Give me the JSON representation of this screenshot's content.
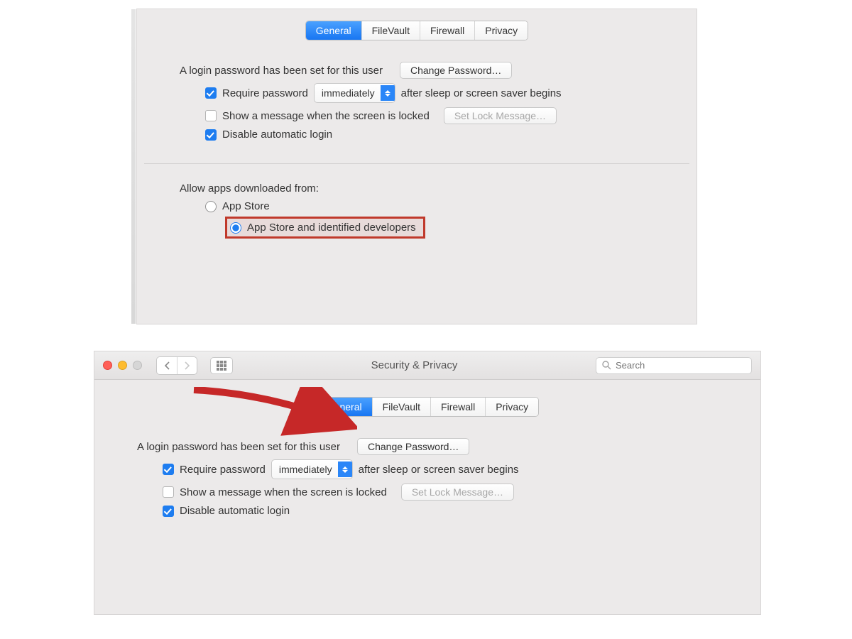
{
  "top": {
    "tabs": {
      "general": "General",
      "filevault": "FileVault",
      "firewall": "Firewall",
      "privacy": "Privacy"
    },
    "login_set_text": "A login password has been set for this user",
    "change_password_btn": "Change Password…",
    "require_password_label": "Require password",
    "require_password_select": "immediately",
    "require_password_tail": "after sleep or screen saver begins",
    "show_message_label": "Show a message when the screen is locked",
    "set_lock_message_btn": "Set Lock Message…",
    "disable_auto_login_label": "Disable automatic login",
    "allow_apps_heading": "Allow apps downloaded from:",
    "radio_app_store": "App Store",
    "radio_identified": "App Store and identified developers"
  },
  "bottom": {
    "window_title": "Security & Privacy",
    "search_placeholder": "Search",
    "tabs": {
      "general": "General",
      "filevault": "FileVault",
      "firewall": "Firewall",
      "privacy": "Privacy"
    },
    "login_set_text": "A login password has been set for this user",
    "change_password_btn": "Change Password…",
    "require_password_label": "Require password",
    "require_password_select": "immediately",
    "require_password_tail": "after sleep or screen saver begins",
    "show_message_label": "Show a message when the screen is locked",
    "set_lock_message_btn": "Set Lock Message…",
    "disable_auto_login_label": "Disable automatic login"
  }
}
